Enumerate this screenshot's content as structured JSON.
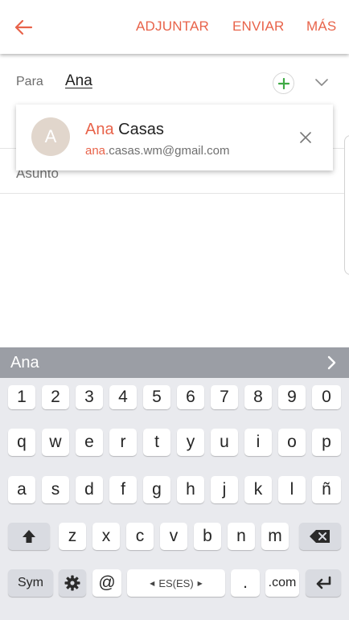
{
  "toolbar": {
    "attach_label": "ADJUNTAR",
    "send_label": "ENVIAR",
    "more_label": "MÁS",
    "accent_color": "#e8634a"
  },
  "compose": {
    "to_label": "Para",
    "to_value": "Ana",
    "subject_placeholder": "Asunto"
  },
  "suggestion": {
    "avatar_letter": "A",
    "name_match": "Ana",
    "name_rest": " Casas",
    "email_match": "ana",
    "email_rest": ".casas.wm@gmail.com"
  },
  "keyboard": {
    "prediction": "Ana",
    "number_row": [
      "1",
      "2",
      "3",
      "4",
      "5",
      "6",
      "7",
      "8",
      "9",
      "0"
    ],
    "row1": [
      "q",
      "w",
      "e",
      "r",
      "t",
      "y",
      "u",
      "i",
      "o",
      "p"
    ],
    "row2": [
      "a",
      "s",
      "d",
      "f",
      "g",
      "h",
      "j",
      "k",
      "l",
      "ñ"
    ],
    "row3": [
      "z",
      "x",
      "c",
      "v",
      "b",
      "n",
      "m"
    ],
    "sym_label": "Sym",
    "at_label": "@",
    "language_label": "ES(ES)",
    "period_label": ".",
    "dotcom_label": ".com"
  }
}
